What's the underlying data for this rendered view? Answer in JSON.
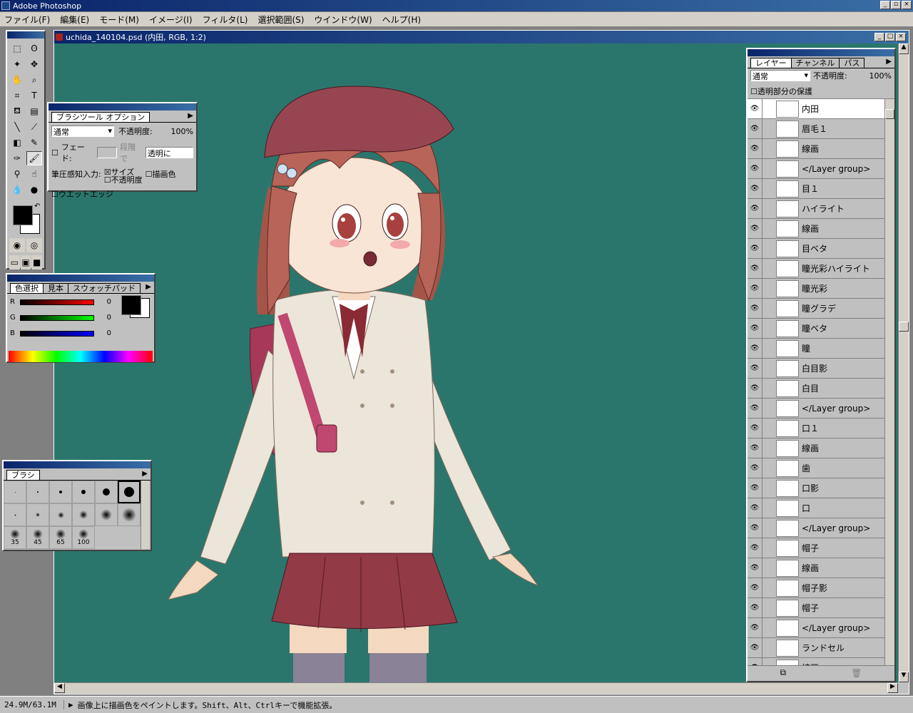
{
  "app": {
    "title": "Adobe Photoshop"
  },
  "menu": [
    "ファイル(F)",
    "編集(E)",
    "モード(M)",
    "イメージ(I)",
    "フィルタ(L)",
    "選択範囲(S)",
    "ウインドウ(W)",
    "ヘルプ(H)"
  ],
  "document": {
    "title": "uchida_140104.psd  (内田, RGB, 1:2)",
    "canvas_color": "#2b766c"
  },
  "brush_options": {
    "title": "ブラシツール オプション",
    "mode": "通常",
    "opacity_label": "不透明度:",
    "opacity_value": "100%",
    "fade_label": "フェード:",
    "step_label": "段階で",
    "fade_target": "透明に",
    "pressure_label": "筆圧感知入力:",
    "size_label": "サイズ",
    "paint_color_label": "描画色",
    "opacity_check_label": "不透明度",
    "wet_edges_label": "ウエットエッジ"
  },
  "color_panel": {
    "tabs": [
      "色選択",
      "見本",
      "スウォッチパッド"
    ],
    "channels": [
      {
        "name": "R",
        "value": "0",
        "color": "#ff0000"
      },
      {
        "name": "G",
        "value": "0",
        "color": "#00ff00"
      },
      {
        "name": "B",
        "value": "0",
        "color": "#0000ff"
      }
    ]
  },
  "brushes_panel": {
    "tab": "ブラシ",
    "sizes": [
      "35",
      "45",
      "65",
      "100"
    ]
  },
  "layers_panel": {
    "tabs": [
      "レイヤー",
      "チャンネル",
      "パス"
    ],
    "mode": "通常",
    "opacity_label": "不透明度:",
    "opacity_value": "100%",
    "preserve_label": "透明部分の保護",
    "layers": [
      "内田",
      "眉毛１",
      "線画",
      "</Layer group>",
      "目１",
      "ハイライト",
      "線画",
      "目ベタ",
      "瞳光彩ハイライト",
      "瞳光彩",
      "瞳グラデ",
      "瞳ベタ",
      "瞳",
      "白目影",
      "白目",
      "</Layer group>",
      "口１",
      "線画",
      "歯",
      "口影",
      "口",
      "</Layer group>",
      "帽子",
      "線画",
      "帽子影",
      "帽子",
      "</Layer group>",
      "ランドセル",
      "線画"
    ]
  },
  "status": {
    "memory": "24.9M/63.1M",
    "message": "画像上に描画色をペイントします。Shift、Alt、Ctrlキーで機能拡張。"
  }
}
